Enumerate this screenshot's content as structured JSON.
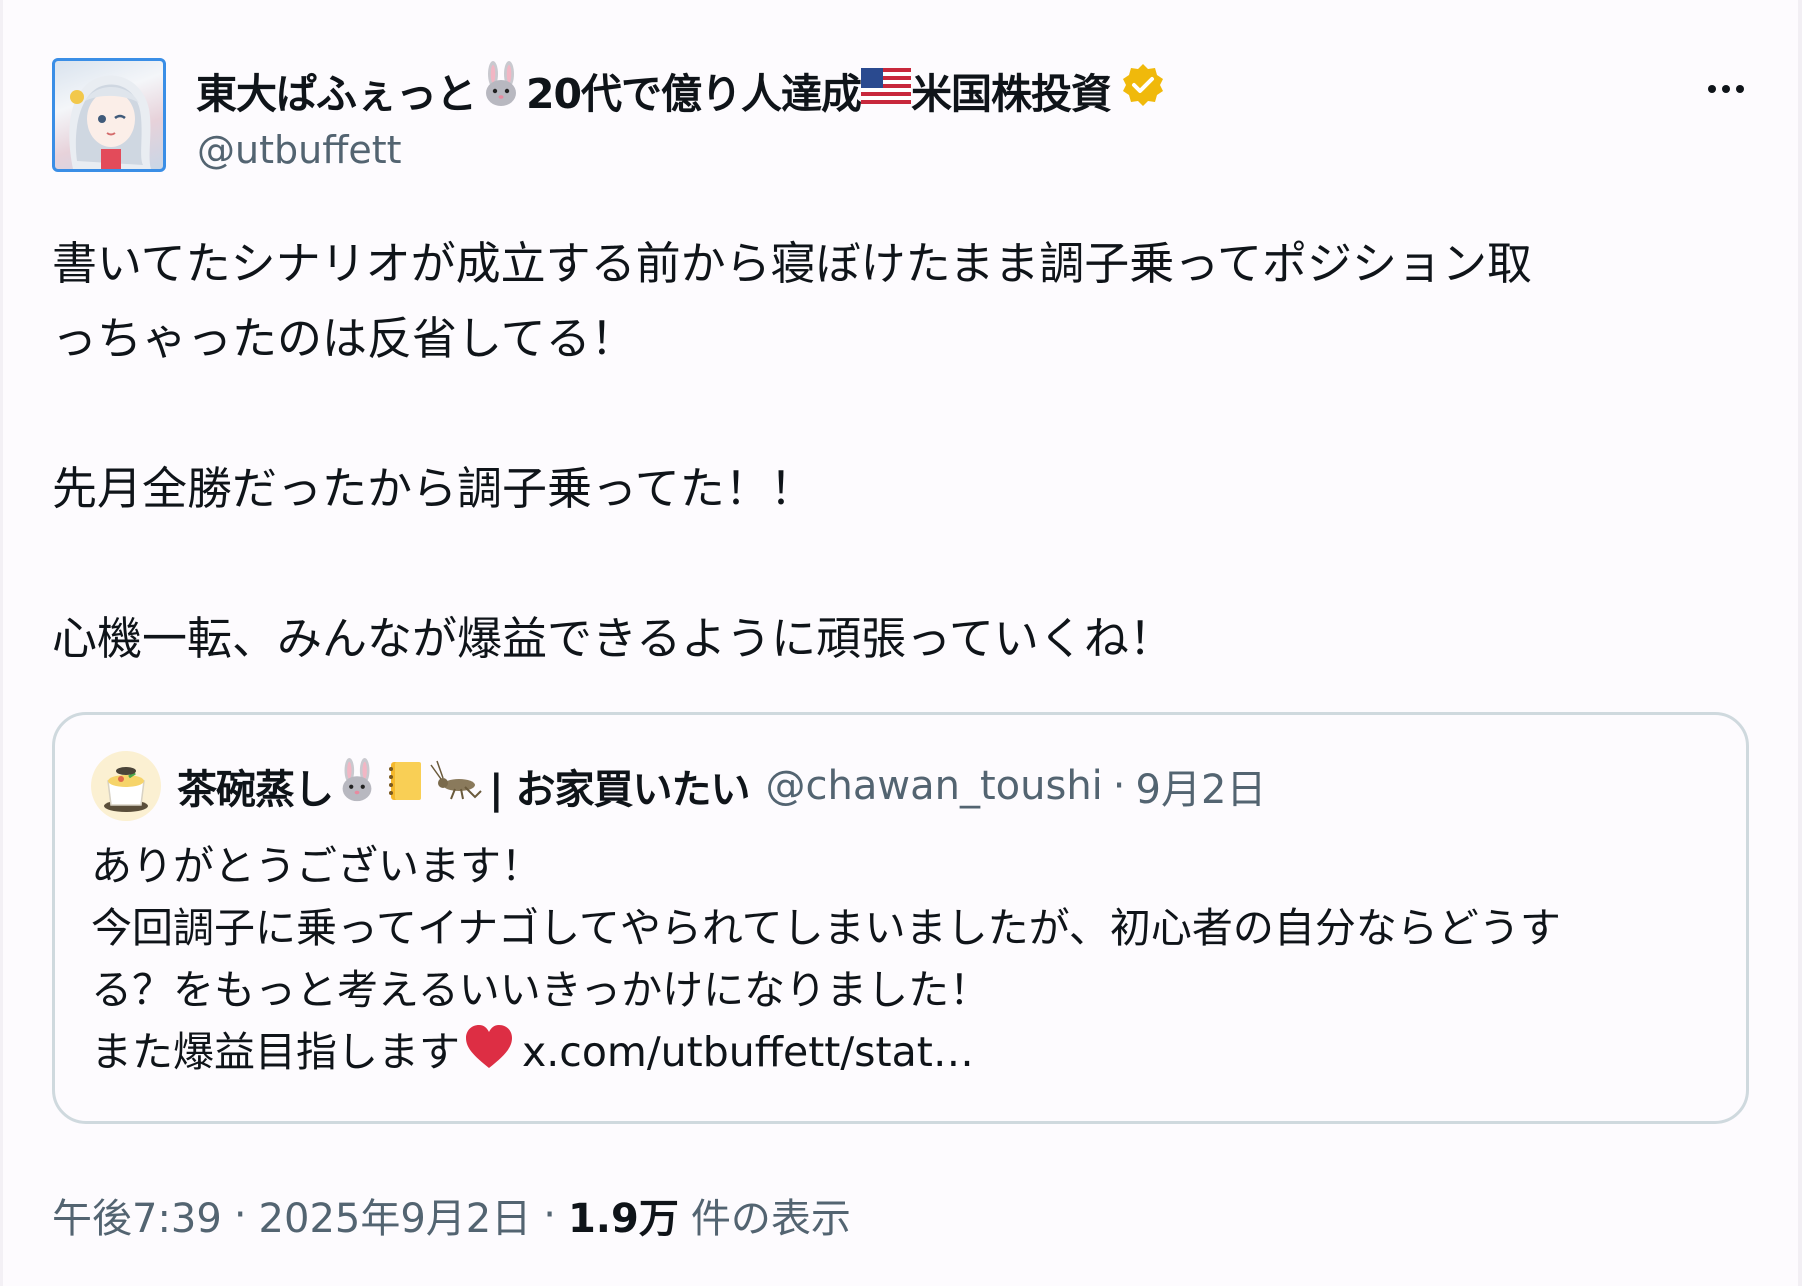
{
  "author": {
    "display_name_part1": "東大ぱふぇっと",
    "display_name_part2": "20代で億り人達成",
    "display_name_part3": "米国株投資",
    "handle": "@utbuffett",
    "verified": true,
    "verified_badge_color": "#f0b90b"
  },
  "tweet": {
    "lines": [
      "書いてたシナリオが成立する前から寝ぼけたまま調子乗ってポジション取",
      "っちゃったのは反省してる！",
      "",
      "先月全勝だったから調子乗ってた！！",
      "",
      "心機一転、みんなが爆益できるように頑張っていくね！"
    ]
  },
  "quote": {
    "name_part1": "茶碗蒸し",
    "name_part2": "| お家買いたい",
    "handle": "@chawan_toushi",
    "separator": "·",
    "date": "9月2日",
    "lines": [
      "ありがとうございます！",
      "今回調子に乗ってイナゴしてやられてしまいましたが、初心者の自分ならどうす",
      "る？をもっと考えるいいきっかけになりました！"
    ],
    "last_line_text": "また爆益目指します",
    "last_line_link": "x.com/utbuffett/stat…"
  },
  "meta": {
    "time": "午後7:39",
    "separator": "·",
    "date": "2025年9月2日",
    "views_count": "1.9万",
    "views_label": "件の表示"
  },
  "colors": {
    "text_primary": "#0f1419",
    "text_secondary": "#536471",
    "border": "#cfd9de",
    "heart": "#e0245e",
    "avatar_border": "#3a8ee6"
  },
  "icons": [
    "rabbit-emoji-icon",
    "us-flag-emoji-icon",
    "verified-badge-icon",
    "more-icon",
    "notebook-emoji-icon",
    "cricket-emoji-icon",
    "heart-emoji-icon"
  ]
}
